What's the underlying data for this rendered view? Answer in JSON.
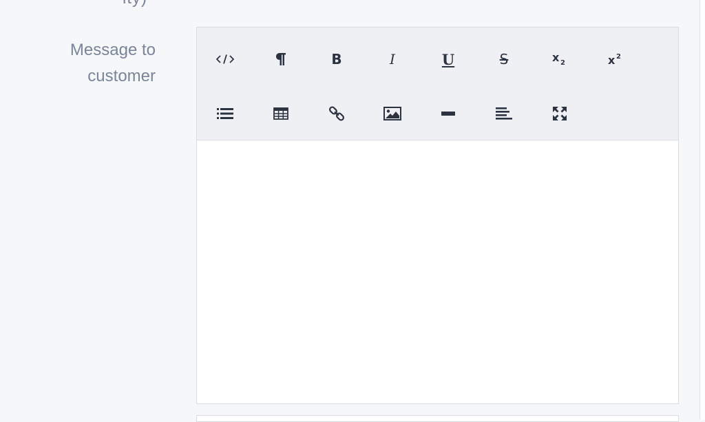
{
  "previous_field": {
    "label_tail": "ity)"
  },
  "message_field": {
    "label_line1": "Message to",
    "label_line2": "customer",
    "content": ""
  },
  "toolbar": {
    "row1": [
      {
        "name": "html-code",
        "icon": "code-icon"
      },
      {
        "name": "paragraph",
        "icon": "pilcrow-icon"
      },
      {
        "name": "bold",
        "icon": "bold-icon",
        "glyph": "B"
      },
      {
        "name": "italic",
        "icon": "italic-icon",
        "glyph": "I"
      },
      {
        "name": "underline",
        "icon": "underline-icon",
        "glyph": "U"
      },
      {
        "name": "strikethrough",
        "icon": "strikethrough-icon",
        "glyph": "S"
      },
      {
        "name": "subscript",
        "icon": "subscript-icon"
      },
      {
        "name": "superscript",
        "icon": "superscript-icon"
      }
    ],
    "row2": [
      {
        "name": "bulleted-list",
        "icon": "list-icon"
      },
      {
        "name": "table",
        "icon": "table-icon"
      },
      {
        "name": "link",
        "icon": "link-icon"
      },
      {
        "name": "image",
        "icon": "image-icon"
      },
      {
        "name": "horizontal-rule",
        "icon": "horizontal-rule-icon"
      },
      {
        "name": "align",
        "icon": "align-left-icon"
      },
      {
        "name": "fullscreen",
        "icon": "fullscreen-icon"
      }
    ]
  },
  "colors": {
    "background": "#f6f7f9",
    "label": "#7a8599",
    "toolbar_bg": "#eff0f4",
    "icon": "#2c3340",
    "border": "#d9dce2"
  }
}
